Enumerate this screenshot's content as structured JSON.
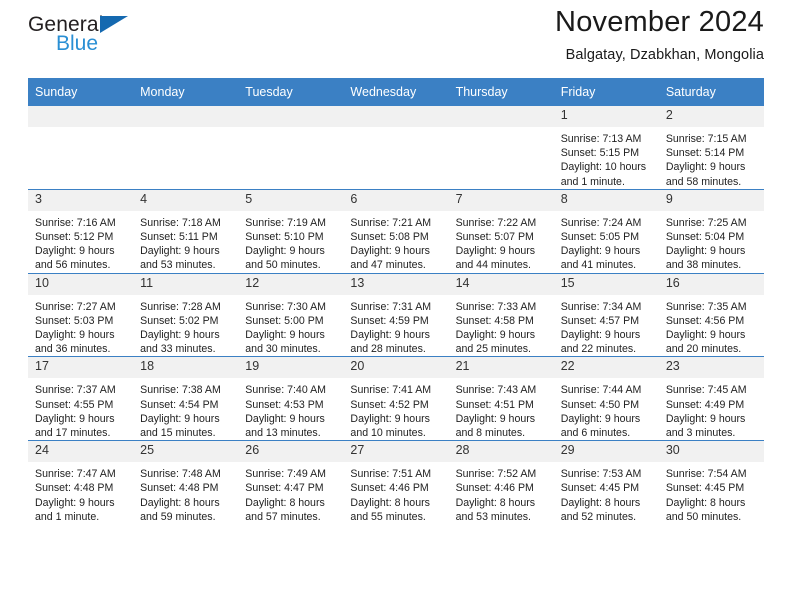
{
  "brand": {
    "line1": "General",
    "line2": "Blue",
    "triangle_color": "#1569b0",
    "line2_color": "#2a8fd4"
  },
  "header": {
    "title": "November 2024",
    "subtitle": "Balgatay, Dzabkhan, Mongolia"
  },
  "theme": {
    "header_row_bg": "#3b80c4",
    "daynum_band_bg": "#f1f1f1",
    "grid_line": "#3b80c4",
    "text": "#222222"
  },
  "weekday_headers": [
    "Sunday",
    "Monday",
    "Tuesday",
    "Wednesday",
    "Thursday",
    "Friday",
    "Saturday"
  ],
  "labels": {
    "sunrise": "Sunrise:",
    "sunset": "Sunset:",
    "daylight": "Daylight:"
  },
  "weeks": [
    [
      {
        "day": "",
        "blank": true
      },
      {
        "day": "",
        "blank": true
      },
      {
        "day": "",
        "blank": true
      },
      {
        "day": "",
        "blank": true
      },
      {
        "day": "",
        "blank": true
      },
      {
        "day": "1",
        "sunrise": "Sunrise: 7:13 AM",
        "sunset": "Sunset: 5:15 PM",
        "daylight": "Daylight: 10 hours and 1 minute."
      },
      {
        "day": "2",
        "sunrise": "Sunrise: 7:15 AM",
        "sunset": "Sunset: 5:14 PM",
        "daylight": "Daylight: 9 hours and 58 minutes."
      }
    ],
    [
      {
        "day": "3",
        "sunrise": "Sunrise: 7:16 AM",
        "sunset": "Sunset: 5:12 PM",
        "daylight": "Daylight: 9 hours and 56 minutes."
      },
      {
        "day": "4",
        "sunrise": "Sunrise: 7:18 AM",
        "sunset": "Sunset: 5:11 PM",
        "daylight": "Daylight: 9 hours and 53 minutes."
      },
      {
        "day": "5",
        "sunrise": "Sunrise: 7:19 AM",
        "sunset": "Sunset: 5:10 PM",
        "daylight": "Daylight: 9 hours and 50 minutes."
      },
      {
        "day": "6",
        "sunrise": "Sunrise: 7:21 AM",
        "sunset": "Sunset: 5:08 PM",
        "daylight": "Daylight: 9 hours and 47 minutes."
      },
      {
        "day": "7",
        "sunrise": "Sunrise: 7:22 AM",
        "sunset": "Sunset: 5:07 PM",
        "daylight": "Daylight: 9 hours and 44 minutes."
      },
      {
        "day": "8",
        "sunrise": "Sunrise: 7:24 AM",
        "sunset": "Sunset: 5:05 PM",
        "daylight": "Daylight: 9 hours and 41 minutes."
      },
      {
        "day": "9",
        "sunrise": "Sunrise: 7:25 AM",
        "sunset": "Sunset: 5:04 PM",
        "daylight": "Daylight: 9 hours and 38 minutes."
      }
    ],
    [
      {
        "day": "10",
        "sunrise": "Sunrise: 7:27 AM",
        "sunset": "Sunset: 5:03 PM",
        "daylight": "Daylight: 9 hours and 36 minutes."
      },
      {
        "day": "11",
        "sunrise": "Sunrise: 7:28 AM",
        "sunset": "Sunset: 5:02 PM",
        "daylight": "Daylight: 9 hours and 33 minutes."
      },
      {
        "day": "12",
        "sunrise": "Sunrise: 7:30 AM",
        "sunset": "Sunset: 5:00 PM",
        "daylight": "Daylight: 9 hours and 30 minutes."
      },
      {
        "day": "13",
        "sunrise": "Sunrise: 7:31 AM",
        "sunset": "Sunset: 4:59 PM",
        "daylight": "Daylight: 9 hours and 28 minutes."
      },
      {
        "day": "14",
        "sunrise": "Sunrise: 7:33 AM",
        "sunset": "Sunset: 4:58 PM",
        "daylight": "Daylight: 9 hours and 25 minutes."
      },
      {
        "day": "15",
        "sunrise": "Sunrise: 7:34 AM",
        "sunset": "Sunset: 4:57 PM",
        "daylight": "Daylight: 9 hours and 22 minutes."
      },
      {
        "day": "16",
        "sunrise": "Sunrise: 7:35 AM",
        "sunset": "Sunset: 4:56 PM",
        "daylight": "Daylight: 9 hours and 20 minutes."
      }
    ],
    [
      {
        "day": "17",
        "sunrise": "Sunrise: 7:37 AM",
        "sunset": "Sunset: 4:55 PM",
        "daylight": "Daylight: 9 hours and 17 minutes."
      },
      {
        "day": "18",
        "sunrise": "Sunrise: 7:38 AM",
        "sunset": "Sunset: 4:54 PM",
        "daylight": "Daylight: 9 hours and 15 minutes."
      },
      {
        "day": "19",
        "sunrise": "Sunrise: 7:40 AM",
        "sunset": "Sunset: 4:53 PM",
        "daylight": "Daylight: 9 hours and 13 minutes."
      },
      {
        "day": "20",
        "sunrise": "Sunrise: 7:41 AM",
        "sunset": "Sunset: 4:52 PM",
        "daylight": "Daylight: 9 hours and 10 minutes."
      },
      {
        "day": "21",
        "sunrise": "Sunrise: 7:43 AM",
        "sunset": "Sunset: 4:51 PM",
        "daylight": "Daylight: 9 hours and 8 minutes."
      },
      {
        "day": "22",
        "sunrise": "Sunrise: 7:44 AM",
        "sunset": "Sunset: 4:50 PM",
        "daylight": "Daylight: 9 hours and 6 minutes."
      },
      {
        "day": "23",
        "sunrise": "Sunrise: 7:45 AM",
        "sunset": "Sunset: 4:49 PM",
        "daylight": "Daylight: 9 hours and 3 minutes."
      }
    ],
    [
      {
        "day": "24",
        "sunrise": "Sunrise: 7:47 AM",
        "sunset": "Sunset: 4:48 PM",
        "daylight": "Daylight: 9 hours and 1 minute."
      },
      {
        "day": "25",
        "sunrise": "Sunrise: 7:48 AM",
        "sunset": "Sunset: 4:48 PM",
        "daylight": "Daylight: 8 hours and 59 minutes."
      },
      {
        "day": "26",
        "sunrise": "Sunrise: 7:49 AM",
        "sunset": "Sunset: 4:47 PM",
        "daylight": "Daylight: 8 hours and 57 minutes."
      },
      {
        "day": "27",
        "sunrise": "Sunrise: 7:51 AM",
        "sunset": "Sunset: 4:46 PM",
        "daylight": "Daylight: 8 hours and 55 minutes."
      },
      {
        "day": "28",
        "sunrise": "Sunrise: 7:52 AM",
        "sunset": "Sunset: 4:46 PM",
        "daylight": "Daylight: 8 hours and 53 minutes."
      },
      {
        "day": "29",
        "sunrise": "Sunrise: 7:53 AM",
        "sunset": "Sunset: 4:45 PM",
        "daylight": "Daylight: 8 hours and 52 minutes."
      },
      {
        "day": "30",
        "sunrise": "Sunrise: 7:54 AM",
        "sunset": "Sunset: 4:45 PM",
        "daylight": "Daylight: 8 hours and 50 minutes."
      }
    ]
  ]
}
